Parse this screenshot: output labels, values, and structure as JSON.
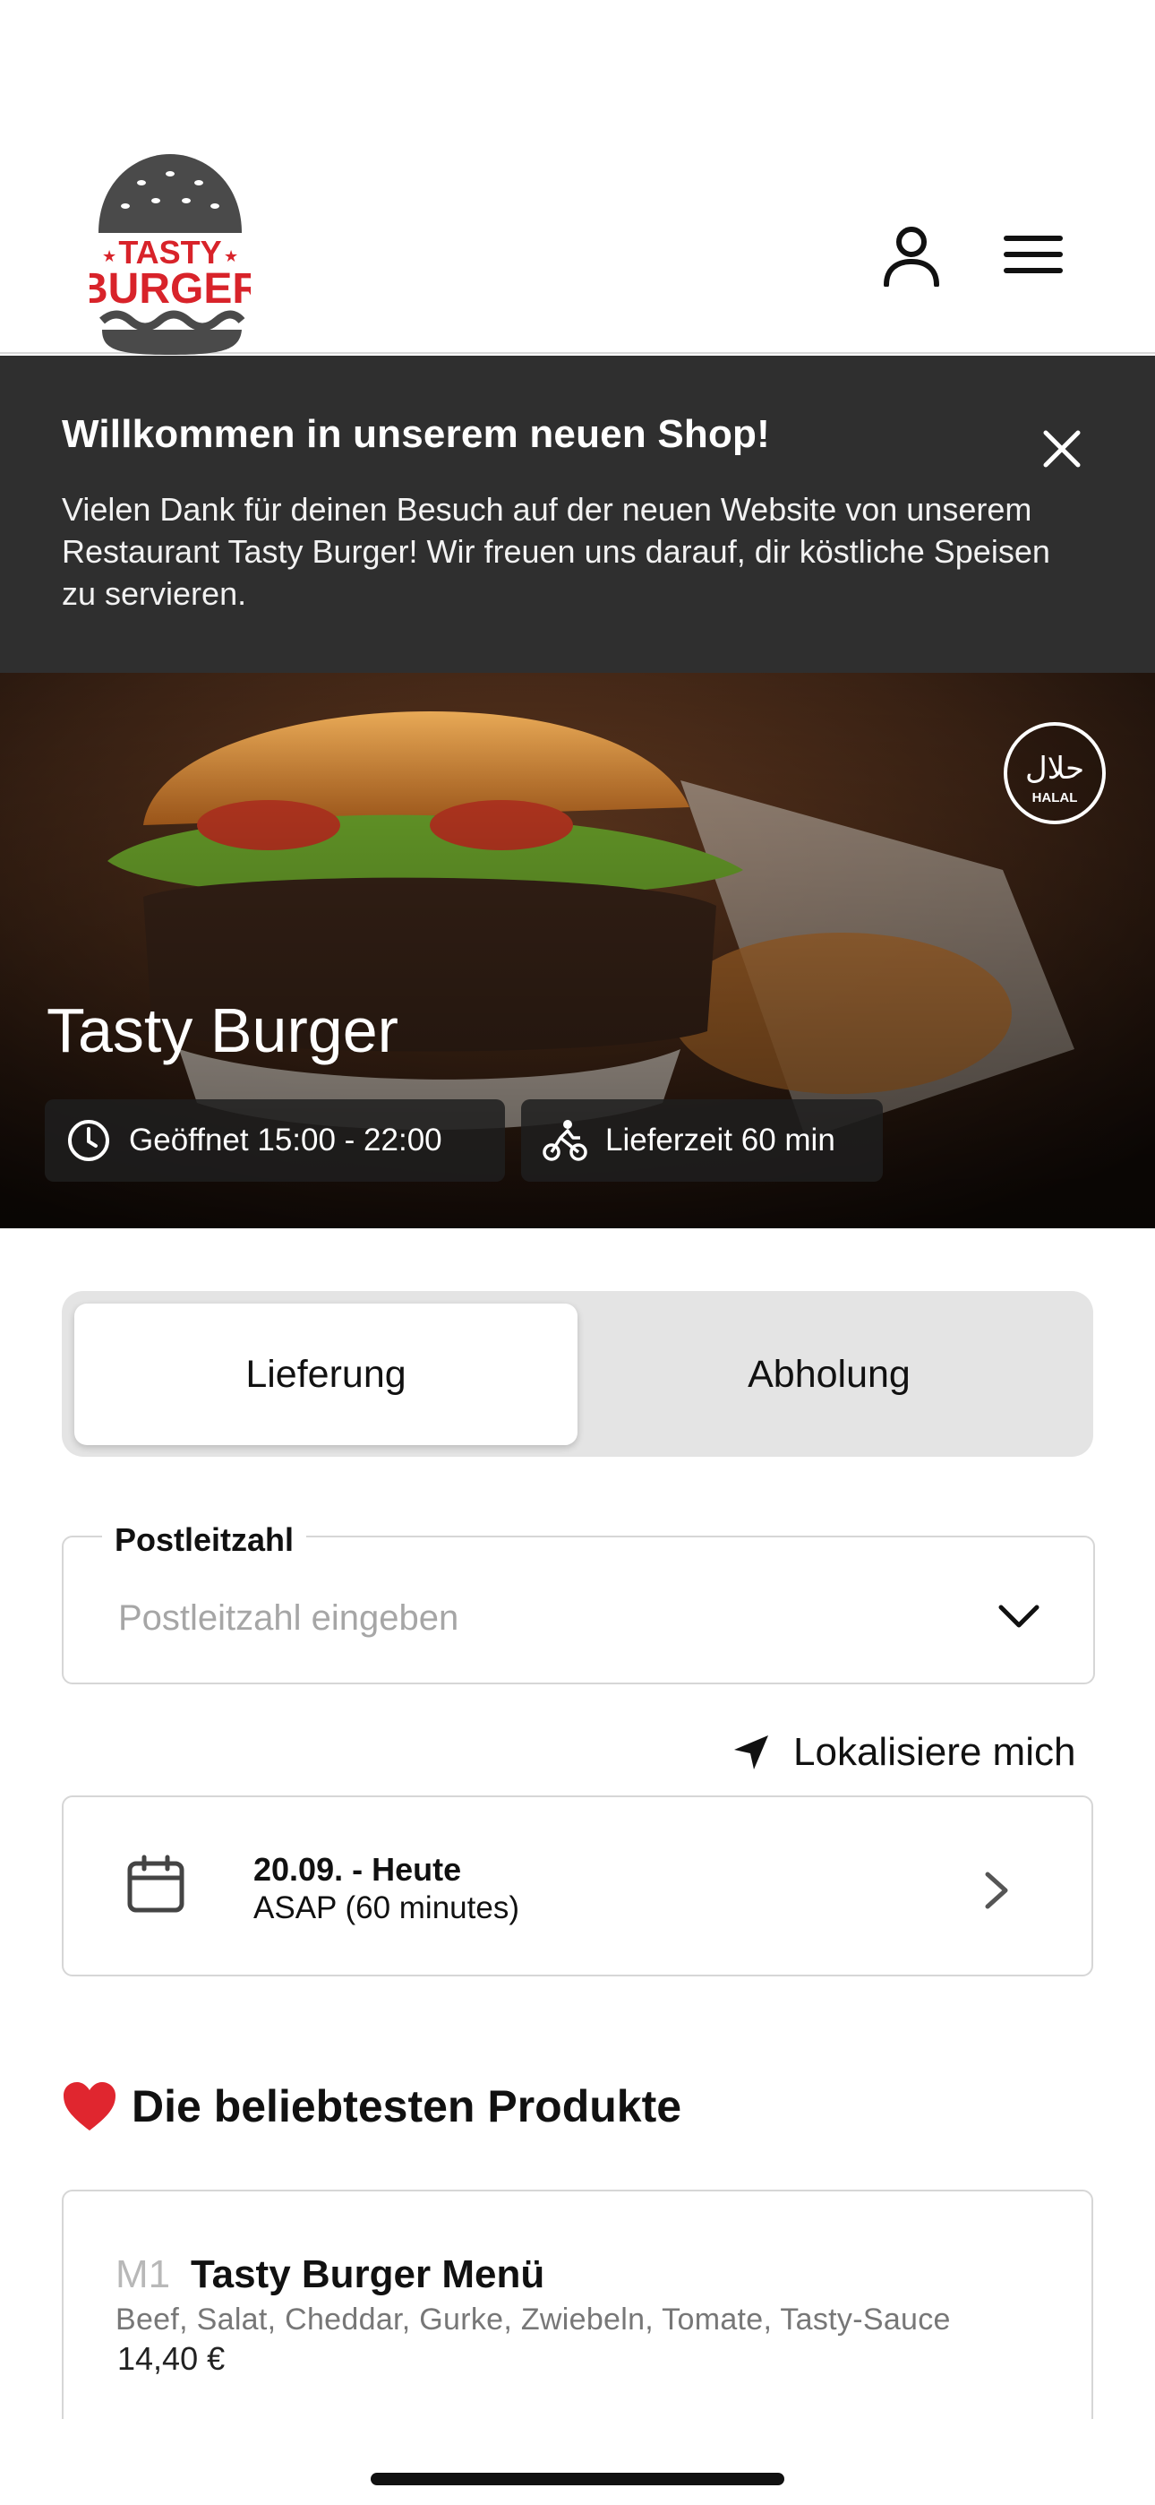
{
  "header": {
    "logo": {
      "line1": "TASTY",
      "line2": "BURGER",
      "icon": "burger-logo"
    },
    "user_icon": "user-icon",
    "menu_icon": "hamburger-menu-icon"
  },
  "banner": {
    "title": "Willkommen in unserem neuen Shop!",
    "text": "Vielen Dank für deinen Besuch auf der neuen Website von unserem Restaurant Tasty Burger! Wir freuen uns darauf, dir köstliche Speisen zu servieren.",
    "close_icon": "close-icon"
  },
  "hero": {
    "restaurant_name": "Tasty Burger",
    "halal_badge": {
      "arabic": "حلال",
      "label": "HALAL"
    },
    "opening_hours": "Geöffnet 15:00 - 22:00",
    "delivery_time": "Lieferzeit 60 min"
  },
  "order_type": {
    "tabs": [
      {
        "label": "Lieferung",
        "active": true
      },
      {
        "label": "Abholung",
        "active": false
      }
    ]
  },
  "postcode": {
    "label": "Postleitzahl",
    "placeholder": "Postleitzahl eingeben",
    "value": ""
  },
  "locate": {
    "label": "Lokalisiere mich"
  },
  "schedule": {
    "date": "20.09. - Heute",
    "time": "ASAP (60 minutes)"
  },
  "popular": {
    "title": "Die beliebtesten Produkte",
    "products": [
      {
        "code": "M1",
        "name": "Tasty Burger Menü",
        "description": "Beef, Salat, Cheddar, Gurke, Zwiebeln, Tomate, Tasty-Sauce",
        "price": "14,40 €"
      }
    ]
  },
  "colors": {
    "banner_bg": "#2f2f2f",
    "logo_red": "#d8232a",
    "logo_gray": "#4a4a4a",
    "tab_bg": "#e4e4e4"
  }
}
